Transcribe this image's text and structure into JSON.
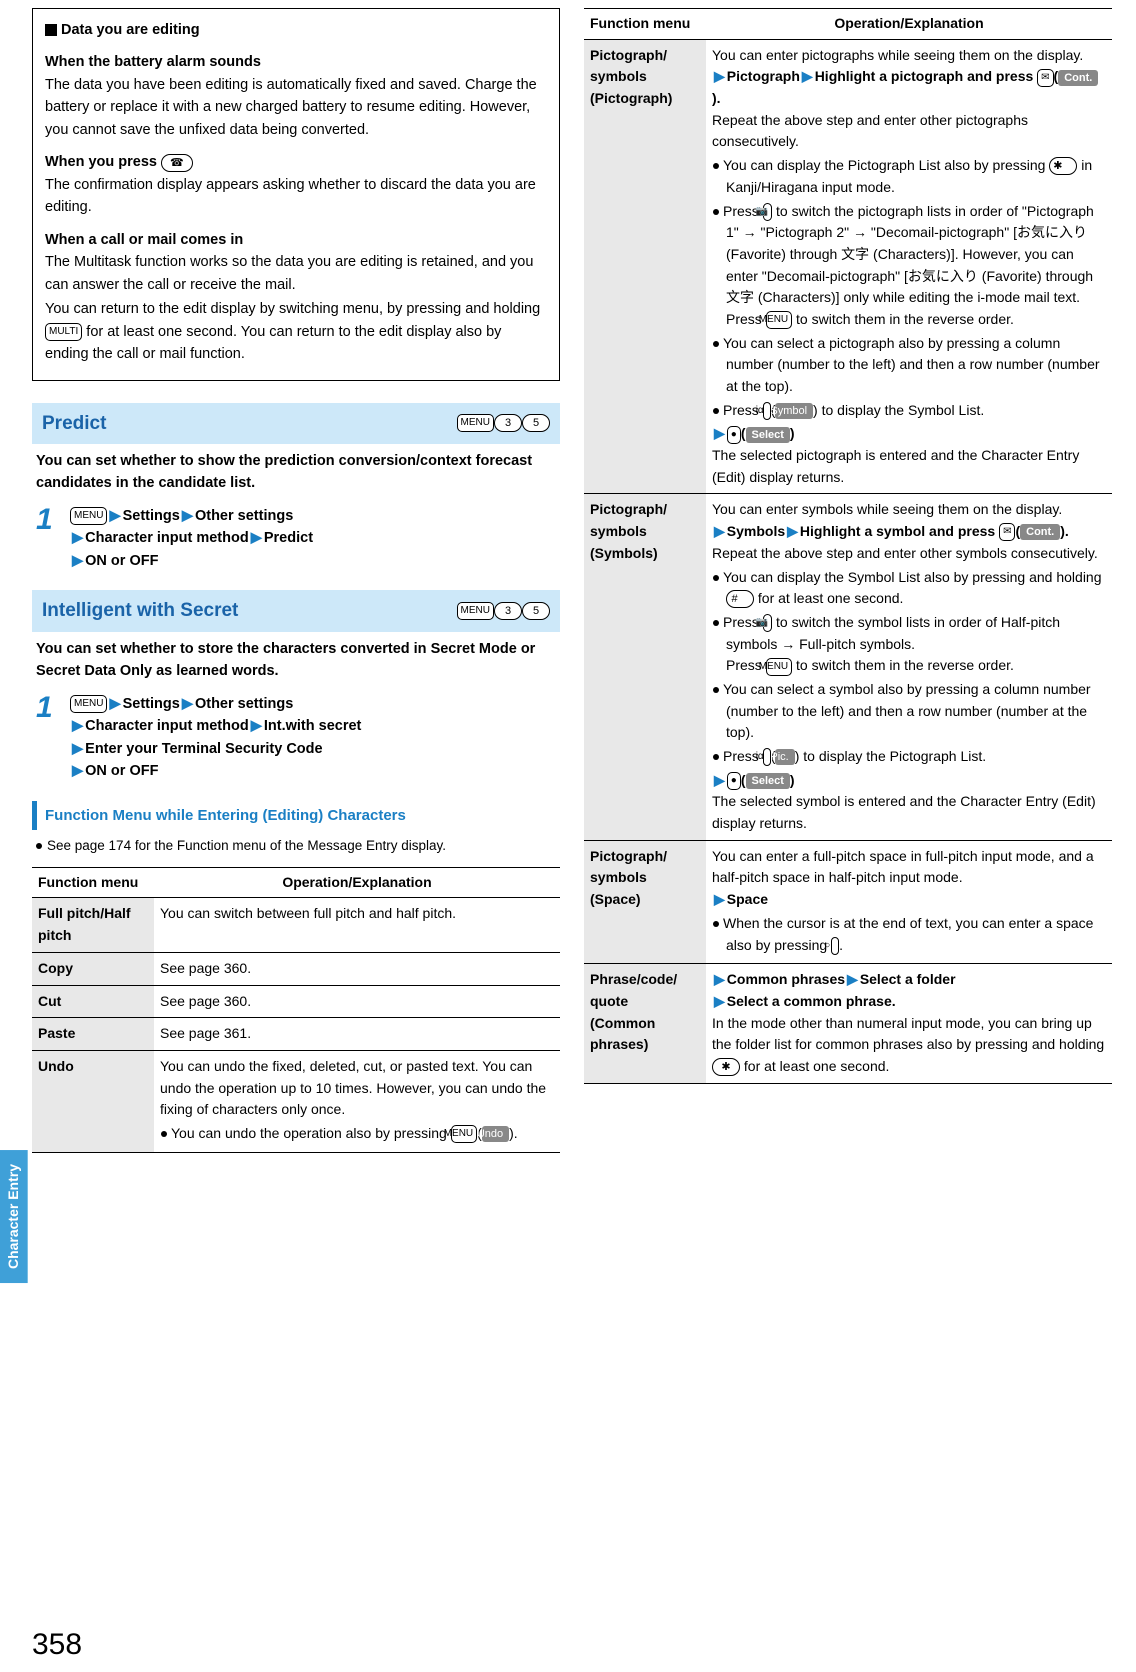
{
  "pageNumber": "358",
  "sideTab": "Character Entry",
  "infoBox": {
    "title": "Data you are editing",
    "s1_title": "When the battery alarm sounds",
    "s1_body": "The data you have been editing is automatically fixed and saved. Charge the battery or replace it with a new charged battery to resume editing. However, you cannot save the unfixed data being converted.",
    "s2_title_pre": "When you press ",
    "s2_key": "☎",
    "s2_body": "The confirmation display appears asking whether to discard the data you are editing.",
    "s3_title": "When a call or mail comes in",
    "s3_body_1": "The Multitask function works so the data you are editing is retained, and you can answer the call or receive the mail.",
    "s3_body_2a": "You can return to the edit display by switching menu, by pressing and holding ",
    "s3_key": "MULTI",
    "s3_body_2b": " for at least one second. You can return to the edit display also by ending the call or mail function."
  },
  "predict": {
    "title": "Predict",
    "shortcut": [
      "MENU",
      "3",
      "5"
    ],
    "lead": "You can set whether to show the prediction conversion/context forecast candidates in the candidate list.",
    "step1": {
      "k": "MENU",
      "a": "Settings",
      "b": "Other settings",
      "c": "Character input method",
      "d": "Predict",
      "e": "ON or OFF"
    }
  },
  "secret": {
    "title": "Intelligent with Secret",
    "shortcut": [
      "MENU",
      "3",
      "5"
    ],
    "lead": "You can set whether to store the characters converted in Secret Mode or Secret Data Only as learned words.",
    "step1": {
      "k": "MENU",
      "a": "Settings",
      "b": "Other settings",
      "c": "Character input method",
      "d": "Int.with secret",
      "e": "Enter your Terminal Security Code",
      "f": "ON or OFF"
    }
  },
  "funcMenuHead": "Function Menu while Entering (Editing) Characters",
  "funcNote": "See page 174 for the Function menu of the Message Entry display.",
  "tableHeaders": {
    "a": "Function menu",
    "b": "Operation/Explanation"
  },
  "rowsLeft": {
    "r1": {
      "fn": "Full pitch/Half pitch",
      "op": "You can switch between full pitch and half pitch."
    },
    "r2": {
      "fn": "Copy",
      "op": "See page 360."
    },
    "r3": {
      "fn": "Cut",
      "op": "See page 360."
    },
    "r4": {
      "fn": "Paste",
      "op": "See page 361."
    },
    "r5": {
      "fn": "Undo",
      "op_a": "You can undo the fixed, deleted, cut, or pasted text. You can undo the operation up to 10 times. However, you can undo the fixing of characters only once.",
      "op_b_pre": "You can undo the operation also by pressing ",
      "op_b_k": "MENU",
      "op_b_badge": "Undo",
      "op_b_post": ")."
    }
  },
  "rowsRight": {
    "r1": {
      "fn": "Pictograph/\nsymbols\n(Pictograph)",
      "l1": "You can enter pictographs while seeing them on the display.",
      "l2_a": "Pictograph",
      "l2_b": "Highlight a pictograph and press ",
      "l2_k": "✉",
      "l2_badge": "Cont.",
      "l2_post": ".",
      "l3": "Repeat the above step and enter other pictographs consecutively.",
      "b1_pre": "You can display the Pictograph List also by pressing ",
      "b1_k": "✱",
      "b1_post": " in Kanji/Hiragana input mode.",
      "b2_pre": "Press ",
      "b2_k": "📷",
      "b2_mid": " to switch the pictograph lists in order of \"Pictograph 1\" → \"Pictograph 2\" → \"Decomail-pictograph\" [お気に入り (Favorite) through 文字 (Characters)]. However, you can enter \"Decomail-pictograph\" [お気に入り (Favorite) through 文字 (Characters)] only while editing the i-mode mail text.",
      "b2_press": "Press ",
      "b2_k2": "MENU",
      "b2_post": " to switch them in the reverse order.",
      "b3": "You can select a pictograph also by pressing a column number (number to the left) and then a row number (number at the top).",
      "b4_pre": "Press ",
      "b4_k": "iα",
      "b4_badge": "Symbol",
      "b4_post": ") to display the Symbol List.",
      "sel_k": "●",
      "sel_badge": "Select",
      "l4": "The selected pictograph is entered and the Character Entry (Edit) display returns."
    },
    "r2": {
      "fn": "Pictograph/\nsymbols\n(Symbols)",
      "l1": "You can enter symbols while seeing them on the display.",
      "l2_a": "Symbols",
      "l2_b": "Highlight a symbol and press ",
      "l2_k": "✉",
      "l2_badge": "Cont.",
      "l2_post": ".",
      "l3": "Repeat the above step and enter other symbols consecutively.",
      "b1_pre": "You can display the Symbol List also by pressing and holding ",
      "b1_k": "#",
      "b1_post": " for at least one second.",
      "b2_pre": "Press ",
      "b2_k": "📷",
      "b2_mid": " to switch the symbol lists in order of Half-pitch symbols → Full-pitch symbols.",
      "b2_press": "Press ",
      "b2_k2": "MENU",
      "b2_post": " to switch them in the reverse order.",
      "b3": "You can select a symbol also by pressing a column number (number to the left) and then a row number (number at the top).",
      "b4_pre": "Press ",
      "b4_k": "iα",
      "b4_badge": "Pic.",
      "b4_post": ") to display the Pictograph List.",
      "sel_k": "●",
      "sel_badge": "Select",
      "l4": "The selected symbol is entered and the Character Entry (Edit) display returns."
    },
    "r3": {
      "fn": "Pictograph/\nsymbols\n(Space)",
      "l1": "You can enter a full-pitch space in full-pitch input mode, and a half-pitch space in half-pitch input mode.",
      "l2": "Space",
      "b1_pre": "When the cursor is at the end of text, you can enter a space also by pressing ",
      "b1_k": "○",
      "b1_post": "."
    },
    "r4": {
      "fn": "Phrase/code/\nquote\n(Common\nphrases)",
      "l1_a": "Common phrases",
      "l1_b": "Select a folder",
      "l1_c": "Select a common phrase.",
      "l2_pre": "In the mode other than numeral input mode, you can bring up the folder list for common phrases also by pressing and holding ",
      "l2_k": "✱",
      "l2_post": " for at least one second."
    }
  }
}
